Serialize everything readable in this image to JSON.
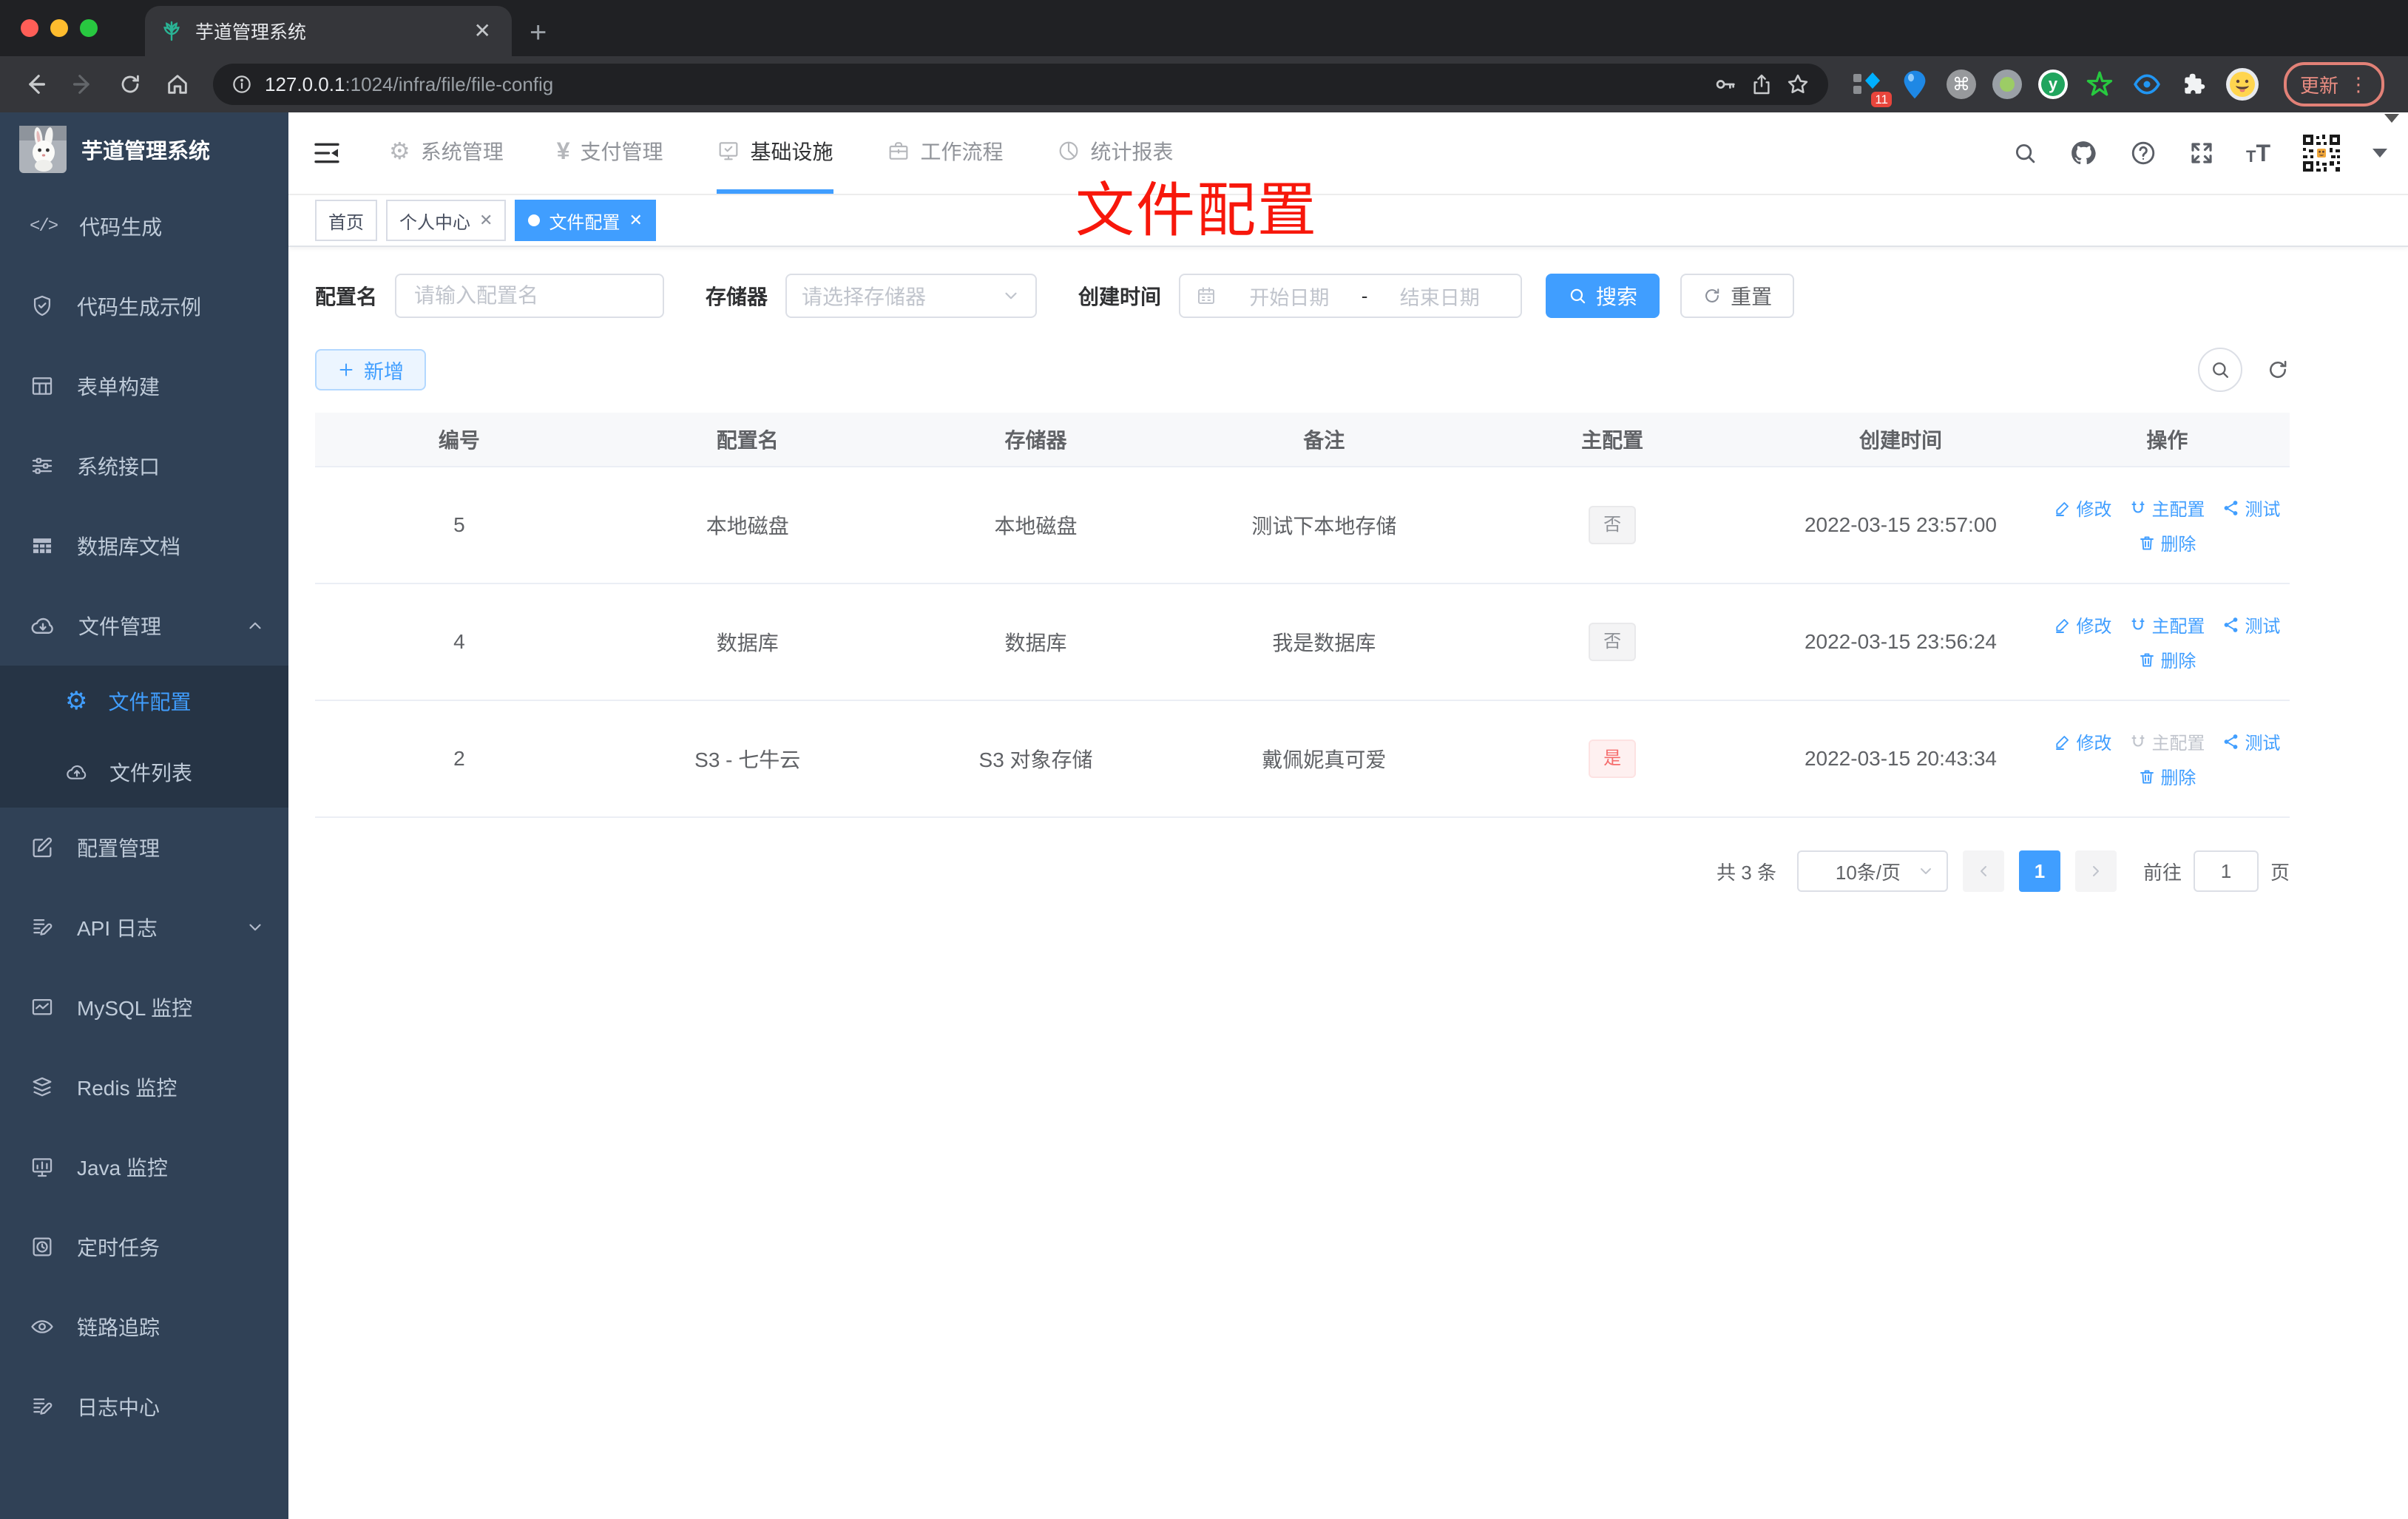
{
  "browser": {
    "tab_title": "芋道管理系统",
    "url_host": "127.0.0.1",
    "url_rest": ":1024/infra/file/file-config",
    "update_label": "更新",
    "extension_badge": "11",
    "ext_y_label": "y"
  },
  "sidebar": {
    "logo_title": "芋道管理系统",
    "items": [
      {
        "label": "代码生成",
        "icon": "code-icon"
      },
      {
        "label": "代码生成示例",
        "icon": "shield-check-icon"
      },
      {
        "label": "表单构建",
        "icon": "form-grid-icon"
      },
      {
        "label": "系统接口",
        "icon": "sliders-icon"
      },
      {
        "label": "数据库文档",
        "icon": "table-icon"
      },
      {
        "label": "文件管理",
        "icon": "cloud-download-icon",
        "expanded": true
      },
      {
        "label": "配置管理",
        "icon": "edit-square-icon"
      },
      {
        "label": "API 日志",
        "icon": "doc-edit-icon",
        "collapsible": true
      },
      {
        "label": "MySQL 监控",
        "icon": "chart-card-icon"
      },
      {
        "label": "Redis 监控",
        "icon": "layers-icon"
      },
      {
        "label": "Java 监控",
        "icon": "monitor-icon"
      },
      {
        "label": "定时任务",
        "icon": "timer-icon"
      },
      {
        "label": "链路追踪",
        "icon": "eye-icon"
      },
      {
        "label": "日志中心",
        "icon": "doc-edit-icon"
      }
    ],
    "submenu": [
      {
        "label": "文件配置",
        "icon": "gear-icon",
        "active": true
      },
      {
        "label": "文件列表",
        "icon": "cloud-upload-icon"
      }
    ]
  },
  "topnav": {
    "items": [
      "系统管理",
      "支付管理",
      "基础设施",
      "工作流程",
      "统计报表"
    ],
    "active": "基础设施"
  },
  "tags": {
    "home": "首页",
    "profile": "个人中心",
    "current": "文件配置"
  },
  "annotation": {
    "text": "文件配置",
    "color": "#f7170b"
  },
  "filters": {
    "name_label": "配置名",
    "name_placeholder": "请输入配置名",
    "storage_label": "存储器",
    "storage_placeholder": "请选择存储器",
    "date_label": "创建时间",
    "date_start_placeholder": "开始日期",
    "date_separator": "-",
    "date_end_placeholder": "结束日期",
    "search_label": "搜索",
    "reset_label": "重置"
  },
  "toolbar": {
    "add_label": "新增"
  },
  "table": {
    "columns": [
      "编号",
      "配置名",
      "存储器",
      "备注",
      "主配置",
      "创建时间",
      "操作"
    ],
    "actions": {
      "edit": "修改",
      "master": "主配置",
      "test": "测试",
      "delete": "删除"
    },
    "rows": [
      {
        "id": "5",
        "name": "本地磁盘",
        "storage": "本地磁盘",
        "remark": "测试下本地存储",
        "master": "否",
        "created": "2022-03-15 23:57:00"
      },
      {
        "id": "4",
        "name": "数据库",
        "storage": "数据库",
        "remark": "我是数据库",
        "master": "否",
        "created": "2022-03-15 23:56:24"
      },
      {
        "id": "2",
        "name": "S3 - 七牛云",
        "storage": "S3 对象存储",
        "remark": "戴佩妮真可爱",
        "master": "是",
        "created": "2022-03-15 20:43:34"
      }
    ]
  },
  "pagination": {
    "total": "共 3 条",
    "page_size": "10条/页",
    "current_page": "1",
    "jump_prefix": "前往",
    "jumper_value": "1",
    "jump_suffix": "页"
  },
  "colors": {
    "accent": "#409eff",
    "sidebar_bg": "#304156",
    "danger": "#f56c6c"
  }
}
